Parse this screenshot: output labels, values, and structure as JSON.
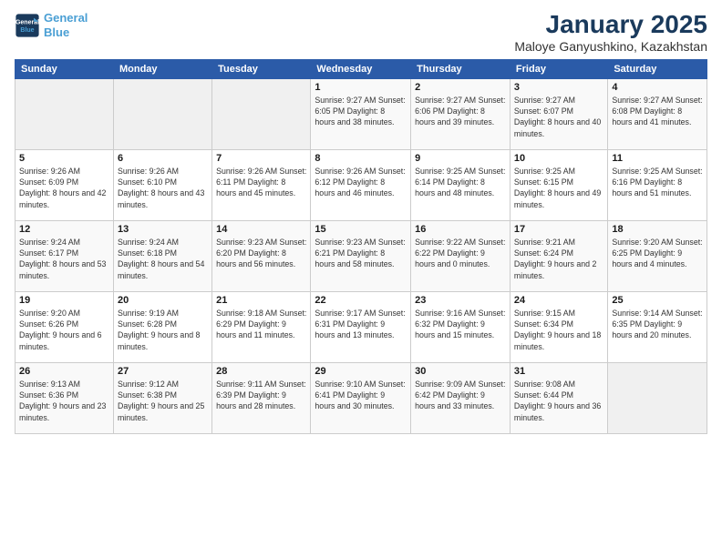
{
  "header": {
    "logo": {
      "line1": "General",
      "line2": "Blue"
    },
    "title": "January 2025",
    "location": "Maloye Ganyushkino, Kazakhstan"
  },
  "weekdays": [
    "Sunday",
    "Monday",
    "Tuesday",
    "Wednesday",
    "Thursday",
    "Friday",
    "Saturday"
  ],
  "weeks": [
    [
      {
        "day": "",
        "info": ""
      },
      {
        "day": "",
        "info": ""
      },
      {
        "day": "",
        "info": ""
      },
      {
        "day": "1",
        "info": "Sunrise: 9:27 AM\nSunset: 6:05 PM\nDaylight: 8 hours and 38 minutes."
      },
      {
        "day": "2",
        "info": "Sunrise: 9:27 AM\nSunset: 6:06 PM\nDaylight: 8 hours and 39 minutes."
      },
      {
        "day": "3",
        "info": "Sunrise: 9:27 AM\nSunset: 6:07 PM\nDaylight: 8 hours and 40 minutes."
      },
      {
        "day": "4",
        "info": "Sunrise: 9:27 AM\nSunset: 6:08 PM\nDaylight: 8 hours and 41 minutes."
      }
    ],
    [
      {
        "day": "5",
        "info": "Sunrise: 9:26 AM\nSunset: 6:09 PM\nDaylight: 8 hours and 42 minutes."
      },
      {
        "day": "6",
        "info": "Sunrise: 9:26 AM\nSunset: 6:10 PM\nDaylight: 8 hours and 43 minutes."
      },
      {
        "day": "7",
        "info": "Sunrise: 9:26 AM\nSunset: 6:11 PM\nDaylight: 8 hours and 45 minutes."
      },
      {
        "day": "8",
        "info": "Sunrise: 9:26 AM\nSunset: 6:12 PM\nDaylight: 8 hours and 46 minutes."
      },
      {
        "day": "9",
        "info": "Sunrise: 9:25 AM\nSunset: 6:14 PM\nDaylight: 8 hours and 48 minutes."
      },
      {
        "day": "10",
        "info": "Sunrise: 9:25 AM\nSunset: 6:15 PM\nDaylight: 8 hours and 49 minutes."
      },
      {
        "day": "11",
        "info": "Sunrise: 9:25 AM\nSunset: 6:16 PM\nDaylight: 8 hours and 51 minutes."
      }
    ],
    [
      {
        "day": "12",
        "info": "Sunrise: 9:24 AM\nSunset: 6:17 PM\nDaylight: 8 hours and 53 minutes."
      },
      {
        "day": "13",
        "info": "Sunrise: 9:24 AM\nSunset: 6:18 PM\nDaylight: 8 hours and 54 minutes."
      },
      {
        "day": "14",
        "info": "Sunrise: 9:23 AM\nSunset: 6:20 PM\nDaylight: 8 hours and 56 minutes."
      },
      {
        "day": "15",
        "info": "Sunrise: 9:23 AM\nSunset: 6:21 PM\nDaylight: 8 hours and 58 minutes."
      },
      {
        "day": "16",
        "info": "Sunrise: 9:22 AM\nSunset: 6:22 PM\nDaylight: 9 hours and 0 minutes."
      },
      {
        "day": "17",
        "info": "Sunrise: 9:21 AM\nSunset: 6:24 PM\nDaylight: 9 hours and 2 minutes."
      },
      {
        "day": "18",
        "info": "Sunrise: 9:20 AM\nSunset: 6:25 PM\nDaylight: 9 hours and 4 minutes."
      }
    ],
    [
      {
        "day": "19",
        "info": "Sunrise: 9:20 AM\nSunset: 6:26 PM\nDaylight: 9 hours and 6 minutes."
      },
      {
        "day": "20",
        "info": "Sunrise: 9:19 AM\nSunset: 6:28 PM\nDaylight: 9 hours and 8 minutes."
      },
      {
        "day": "21",
        "info": "Sunrise: 9:18 AM\nSunset: 6:29 PM\nDaylight: 9 hours and 11 minutes."
      },
      {
        "day": "22",
        "info": "Sunrise: 9:17 AM\nSunset: 6:31 PM\nDaylight: 9 hours and 13 minutes."
      },
      {
        "day": "23",
        "info": "Sunrise: 9:16 AM\nSunset: 6:32 PM\nDaylight: 9 hours and 15 minutes."
      },
      {
        "day": "24",
        "info": "Sunrise: 9:15 AM\nSunset: 6:34 PM\nDaylight: 9 hours and 18 minutes."
      },
      {
        "day": "25",
        "info": "Sunrise: 9:14 AM\nSunset: 6:35 PM\nDaylight: 9 hours and 20 minutes."
      }
    ],
    [
      {
        "day": "26",
        "info": "Sunrise: 9:13 AM\nSunset: 6:36 PM\nDaylight: 9 hours and 23 minutes."
      },
      {
        "day": "27",
        "info": "Sunrise: 9:12 AM\nSunset: 6:38 PM\nDaylight: 9 hours and 25 minutes."
      },
      {
        "day": "28",
        "info": "Sunrise: 9:11 AM\nSunset: 6:39 PM\nDaylight: 9 hours and 28 minutes."
      },
      {
        "day": "29",
        "info": "Sunrise: 9:10 AM\nSunset: 6:41 PM\nDaylight: 9 hours and 30 minutes."
      },
      {
        "day": "30",
        "info": "Sunrise: 9:09 AM\nSunset: 6:42 PM\nDaylight: 9 hours and 33 minutes."
      },
      {
        "day": "31",
        "info": "Sunrise: 9:08 AM\nSunset: 6:44 PM\nDaylight: 9 hours and 36 minutes."
      },
      {
        "day": "",
        "info": ""
      }
    ]
  ]
}
